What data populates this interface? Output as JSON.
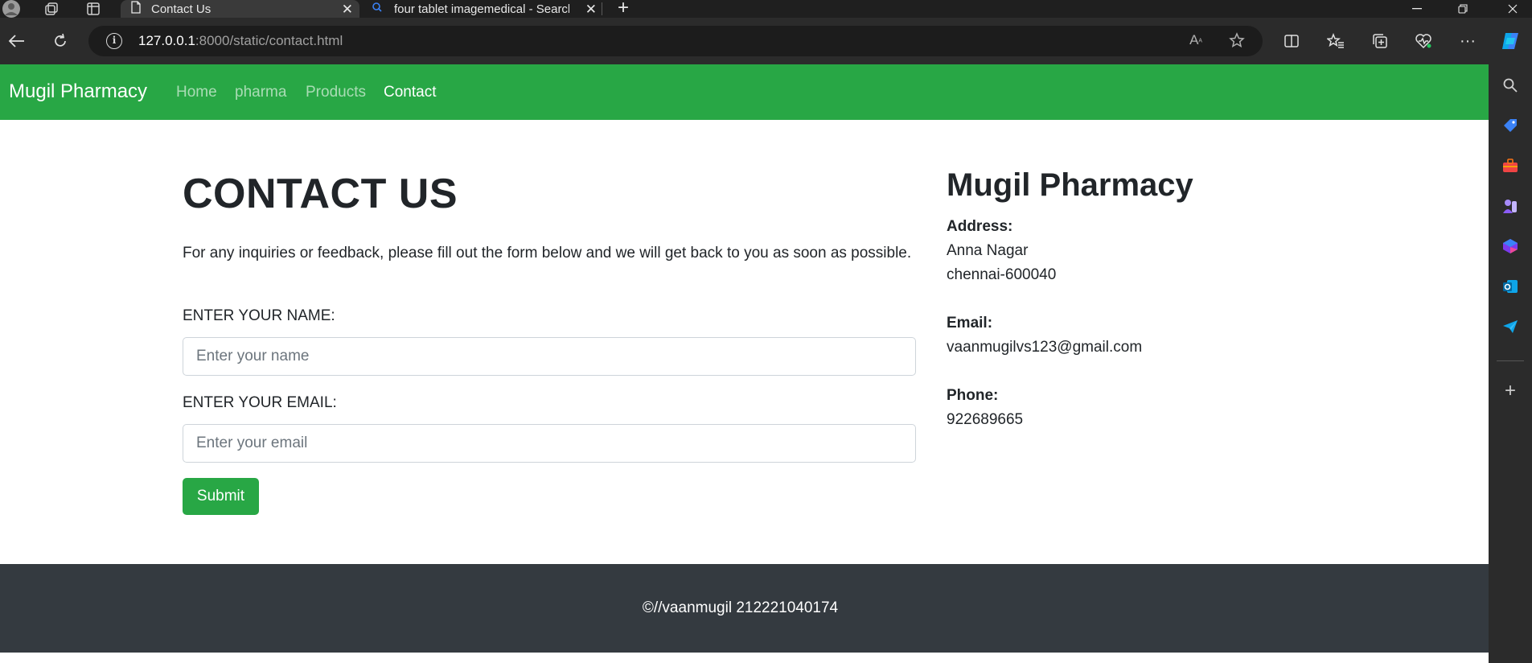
{
  "browser": {
    "tabs": [
      {
        "title": "Contact Us",
        "active": true
      },
      {
        "title": "four tablet imagemedical - Search",
        "active": false
      }
    ],
    "url": {
      "host": "127.0.0.1",
      "rest": ":8000/static/contact.html"
    }
  },
  "nav": {
    "brand": "Mugil Pharmacy",
    "links": [
      "Home",
      "pharma",
      "Products",
      "Contact"
    ],
    "active_link": "Contact"
  },
  "contact": {
    "heading": "CONTACT US",
    "intro": "For any inquiries or feedback, please fill out the form below and we will get back to you as soon as possible.",
    "name_label": "ENTER YOUR NAME:",
    "name_placeholder": "Enter your name",
    "email_label": "ENTER YOUR EMAIL:",
    "email_placeholder": "Enter your email",
    "submit_label": "Submit"
  },
  "info": {
    "title": "Mugil Pharmacy",
    "address_label": "Address:",
    "address_lines": [
      "Anna Nagar",
      "chennai-600040"
    ],
    "email_label": "Email:",
    "email": "vaanmugilvs123@gmail.com",
    "phone_label": "Phone:",
    "phone": "922689665"
  },
  "footer": {
    "text": "©//vaanmugil 212221040174"
  },
  "colors": {
    "brand_green": "#28a745",
    "footer_dark": "#343a40",
    "text": "#212529"
  },
  "icons": [
    "profile-icon",
    "workspaces-icon",
    "tab-actions-icon",
    "page-icon",
    "search-icon",
    "close-icon",
    "new-tab-icon",
    "back-icon",
    "refresh-icon",
    "info-icon",
    "read-aloud-icon",
    "favorite-star-icon",
    "split-screen-icon",
    "favorites-icon",
    "collections-icon",
    "browser-essentials-icon",
    "more-icon",
    "copilot-icon",
    "sidebar-search-icon",
    "shopping-icon",
    "tools-icon",
    "games-icon",
    "microsoft-365-icon",
    "outlook-icon",
    "drop-icon",
    "add-icon"
  ]
}
